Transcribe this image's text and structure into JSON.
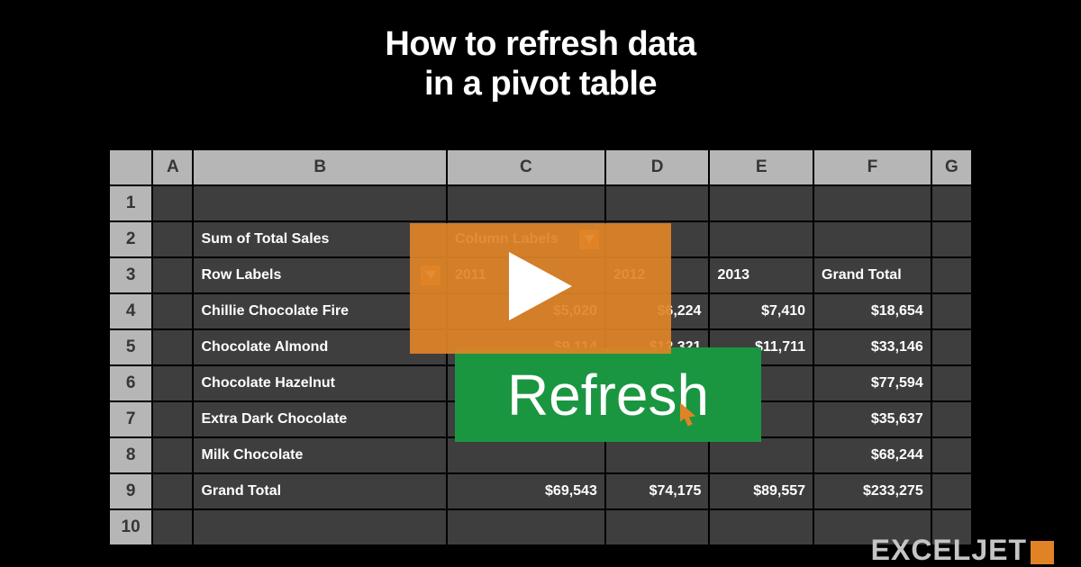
{
  "title_line1": "How to refresh data",
  "title_line2": "in a pivot table",
  "columns": [
    "A",
    "B",
    "C",
    "D",
    "E",
    "F",
    "G"
  ],
  "row_nums": [
    "1",
    "2",
    "3",
    "4",
    "5",
    "6",
    "7",
    "8",
    "9",
    "10"
  ],
  "cells": {
    "r2": {
      "b": "Sum of Total Sales",
      "c": "Column Labels"
    },
    "r3": {
      "b": "Row Labels",
      "c": "2011",
      "d": "2012",
      "e": "2013",
      "f": "Grand Total"
    },
    "r4": {
      "b": "Chillie Chocolate Fire",
      "c": "$5,020",
      "d": "$6,224",
      "e": "$7,410",
      "f": "$18,654"
    },
    "r5": {
      "b": "Chocolate Almond",
      "c": "$9,114",
      "d": "$12,321",
      "e": "$11,711",
      "f": "$33,146"
    },
    "r6": {
      "b": "Chocolate Hazelnut",
      "f": "$77,594"
    },
    "r7": {
      "b": "Extra Dark Chocolate",
      "f": "$35,637"
    },
    "r8": {
      "b": "Milk Chocolate",
      "f": "$68,244"
    },
    "r9": {
      "b": "Grand Total",
      "c": "$69,543",
      "d": "$74,175",
      "e": "$89,557",
      "f": "$233,275"
    }
  },
  "refresh_label": "Refresh",
  "logo_text": "EXCELJET"
}
